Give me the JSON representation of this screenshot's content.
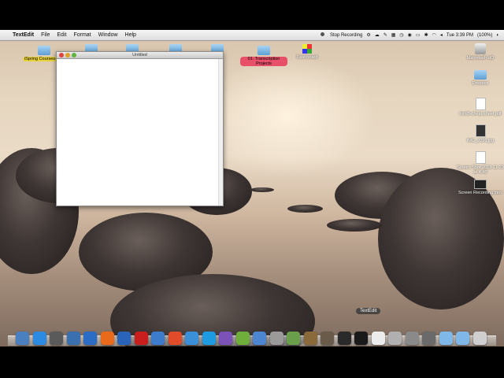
{
  "menubar": {
    "apple_symbol": "",
    "app_name": "TextEdit",
    "menus": [
      "File",
      "Edit",
      "Format",
      "Window",
      "Help"
    ],
    "stop_recording": "Stop Recording",
    "clock": "Tue 3:39 PM",
    "battery": "(100%)"
  },
  "desktop": {
    "icons_left": [
      {
        "label": "iSpring Courses-201"
      },
      {
        "label": "01. Transcription Projects"
      },
      {
        "label": "Dashboard"
      }
    ],
    "icons_right": [
      {
        "label": "Macintosh HD"
      },
      {
        "label": "Dropbox"
      },
      {
        "label": "html5-cheat-sheet.pdf"
      },
      {
        "label": "IMG_2096.jpg"
      },
      {
        "label": "Screen Shot 2012-11-20 at 4.46"
      },
      {
        "label": "Screen Recording.mov"
      }
    ]
  },
  "window": {
    "title": "Untitled",
    "content": ""
  },
  "dock": {
    "tooltip": "TextEdit",
    "apps": [
      "Finder",
      "Safari",
      "Launchpad",
      "VirtualBox",
      "Word",
      "Firefox",
      "Thunderbird",
      "Opera",
      "Network Utility",
      "Chrome",
      "iTunes",
      "Skype",
      "X11",
      "Utility",
      "Preview",
      "Tool",
      "Photos",
      "iBooks",
      "Books",
      "Kindle",
      "Terminal",
      "TextEdit",
      "Storage",
      "System Preferences",
      "Automator",
      "Applications",
      "Documents",
      "Trash"
    ],
    "colors": [
      "#4a7fc0",
      "#2c8be0",
      "#5a5a5a",
      "#3a6fb0",
      "#2b6cc4",
      "#e86a1a",
      "#2a64b8",
      "#c81e1e",
      "#3d7ccc",
      "#e04b2a",
      "#3b8fd8",
      "#1e9be0",
      "#7a52b8",
      "#6fae3a",
      "#4d86d0",
      "#9a9a9a",
      "#6a9e4a",
      "#8a6a3a",
      "#6a5a4a",
      "#2a2a2a",
      "#1a1a1a",
      "#ececec",
      "#b0b0b0",
      "#8a8a8a",
      "#6a6a6a",
      "#7fb8e8",
      "#7fb8e8",
      "#cfcfcf"
    ]
  }
}
